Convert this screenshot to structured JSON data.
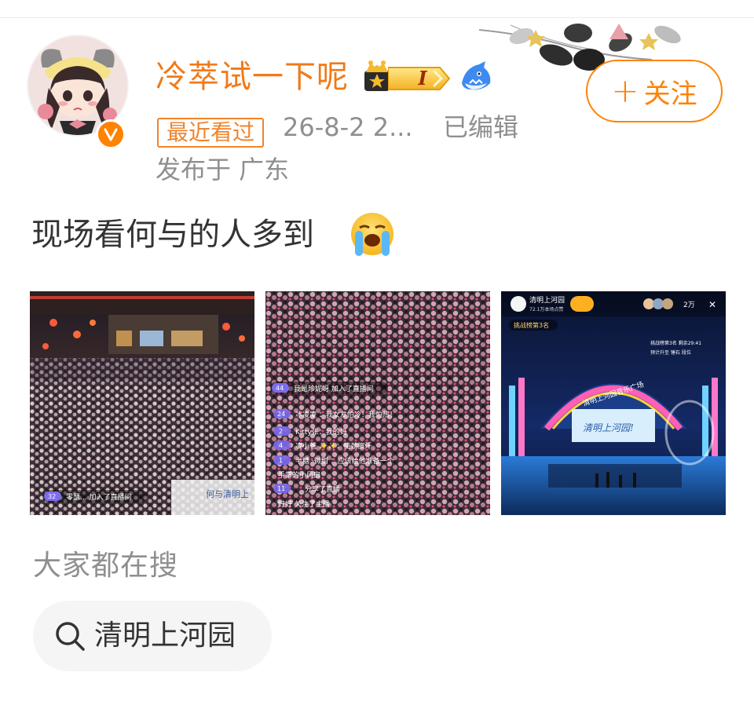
{
  "user": {
    "name": "冷萃试一下呢",
    "level": "I",
    "badges": [
      "crown-icon",
      "shark-icon"
    ],
    "verified": true
  },
  "post": {
    "recent_tag": "最近看过",
    "timestamp": "26-8-2 2...",
    "edited": "已编辑",
    "location": "发布于 广东",
    "text": "现场看何与的人多到",
    "emoji": "crying-face-emoji"
  },
  "follow_button": {
    "plus": "+",
    "label": "关注"
  },
  "images": {
    "img1": {
      "overlay_count": "32",
      "overlay_text": "零瑟... 加入了直播间",
      "sign_text": "何与清明上"
    },
    "img2": {
      "join": {
        "count": "44",
        "text": "我是珍妮呀 加入了直播间"
      },
      "comments": [
        {
          "count": "24",
          "text": "冰凌凌 ：我女友怕冷！我怕热！"
        },
        {
          "count": "2",
          "text": "Kitty张：我的妈"
        },
        {
          "count": "4",
          "text": "凌小爸 ✨✨：使劲擦汗"
        },
        {
          "count": "1",
          "text": "半糖 ·微甜 ：应该给他准备一个"
        },
        {
          "count": "",
          "text": "手掌的小风扇"
        },
        {
          "count": "11",
          "text": "分享了直播"
        },
        {
          "count": "",
          "text": "好好 关注了主播"
        }
      ]
    },
    "img3": {
      "channel": "清明上河园",
      "viewers_sub": "72.1万本场点赞",
      "viewer_count": "2万",
      "rank_tag": "挑战榜第3名",
      "rank_info_1": "挑战榜第3名  剩余29:41",
      "rank_info_2": "预计升至 锤石 段位",
      "stage_banner": "清明上河园音乐广场",
      "stage_script": "清明上河园!"
    }
  },
  "search_section": {
    "title": "大家都在搜",
    "chip": "清明上河园"
  },
  "colors": {
    "accent": "#ff8200",
    "username": "#f07a19",
    "meta_gray": "#8f8f8f",
    "text": "#333333"
  }
}
